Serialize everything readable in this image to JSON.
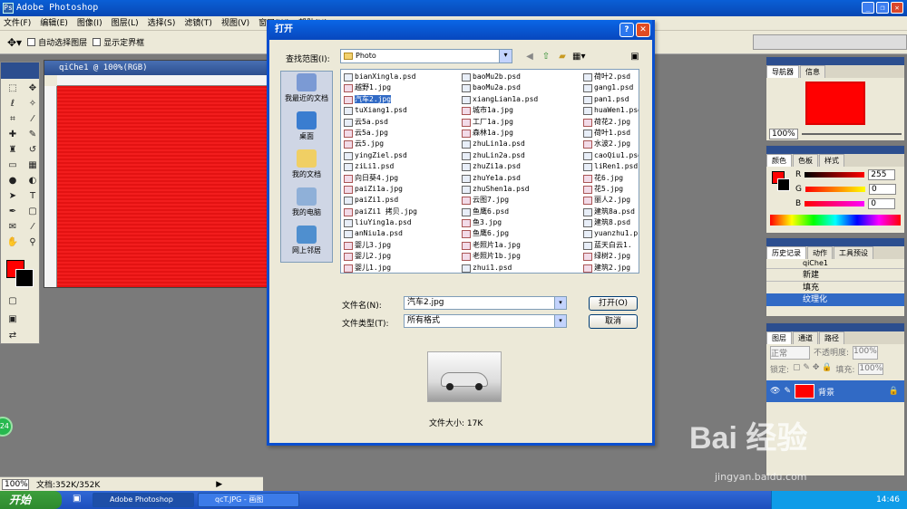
{
  "app": {
    "title": "Adobe Photoshop"
  },
  "menu": [
    "文件(F)",
    "编辑(E)",
    "图像(I)",
    "图层(L)",
    "选择(S)",
    "滤镜(T)",
    "视图(V)",
    "窗口(W)",
    "帮助(H)"
  ],
  "options": {
    "auto_select": "自动选择图层",
    "show_bounds": "显示定界框"
  },
  "document": {
    "title": "qiChe1 @ 100%(RGB)"
  },
  "status": {
    "zoom": "100%",
    "doc_info": "文档:352K/352K"
  },
  "dialog": {
    "title": "打开",
    "look_in_label": "查找范围(I):",
    "look_in_value": "Photo",
    "places": [
      "我最近的文档",
      "桌面",
      "我的文档",
      "我的电脑",
      "网上邻居"
    ],
    "columns": [
      [
        "bianXingla.psd",
        "越野1.jpg",
        "汽车2.jpg",
        "tuXiang1.psd",
        "云5a.psd",
        "云5a.jpg",
        "云5.jpg",
        "yingZiel.psd",
        "ziLi1.psd",
        "向日葵4.jpg",
        "paiZi1a.jpg",
        "paiZi1.psd",
        "paiZi1 拷贝.jpg",
        "liuYing1a.psd",
        "anNiu1a.psd",
        "婴儿3.jpg",
        "婴儿2.jpg",
        "婴儿1.jpg"
      ],
      [
        "baoMu2b.psd",
        "baoMu2a.psd",
        "xiangLian1a.psd",
        "城市1a.jpg",
        "工厂1a.jpg",
        "森林1a.jpg",
        "zhuLin1a.psd",
        "zhuLin2a.psd",
        "zhuZi1a.psd",
        "zhuYe1a.psd",
        "zhuShen1a.psd",
        "云图7.jpg",
        "鱼鹰6.psd",
        "鱼3.jpg",
        "鱼鹰6.jpg",
        "老照片1a.jpg",
        "老照片1b.jpg",
        "zhui1.psd"
      ],
      [
        "荷叶2.psd",
        "gang1.psd",
        "pan1.psd",
        "huaWen1.psd",
        "荷花2.jpg",
        "荷叶1.psd",
        "水波2.jpg",
        "caoQiu1.psd",
        "liRen1.psd",
        "花6.jpg",
        "花5.jpg",
        "丽人2.jpg",
        "建筑8a.psd",
        "建筑8.psd",
        "yuanzhu1.psd",
        "蓝天白云1.",
        "绿树2.jpg",
        "建筑2.jpg"
      ]
    ],
    "selected_file": "汽车2.jpg",
    "filename_label": "文件名(N):",
    "filename_value": "汽车2.jpg",
    "filetype_label": "文件类型(T):",
    "filetype_value": "所有格式",
    "open_button": "打开(O)",
    "cancel_button": "取消",
    "file_size": "文件大小: 17K"
  },
  "panels": {
    "navigator": {
      "tabs": [
        "导航器",
        "信息"
      ],
      "zoom": "100%"
    },
    "color": {
      "tabs": [
        "颜色",
        "色板",
        "样式"
      ],
      "r_label": "R",
      "g_label": "G",
      "b_label": "B",
      "r": "255",
      "g": "0",
      "b": "0"
    },
    "history": {
      "tabs": [
        "历史记录",
        "动作",
        "工具预设"
      ],
      "doc": "qiChe1",
      "items": [
        "新建",
        "填充",
        "纹理化"
      ]
    },
    "layers": {
      "tabs": [
        "图层",
        "通道",
        "路径"
      ],
      "mode": "正常",
      "opacity_label": "不透明度:",
      "opacity": "100%",
      "lock_label": "锁定:",
      "fill_label": "填充:",
      "fill": "100%",
      "layer_name": "背景"
    }
  },
  "taskbar": {
    "start": "开始",
    "tasks": [
      "Adobe Photoshop",
      "qcT.JPG - 画图"
    ],
    "clock": "14:46",
    "ball": "24"
  },
  "watermark": {
    "logo": "Bai 经验",
    "url": "jingyan.baidu.com"
  },
  "colors": {
    "accent": "#0a4fcf",
    "canvas": "#f00000",
    "selection": "#316ac5"
  }
}
